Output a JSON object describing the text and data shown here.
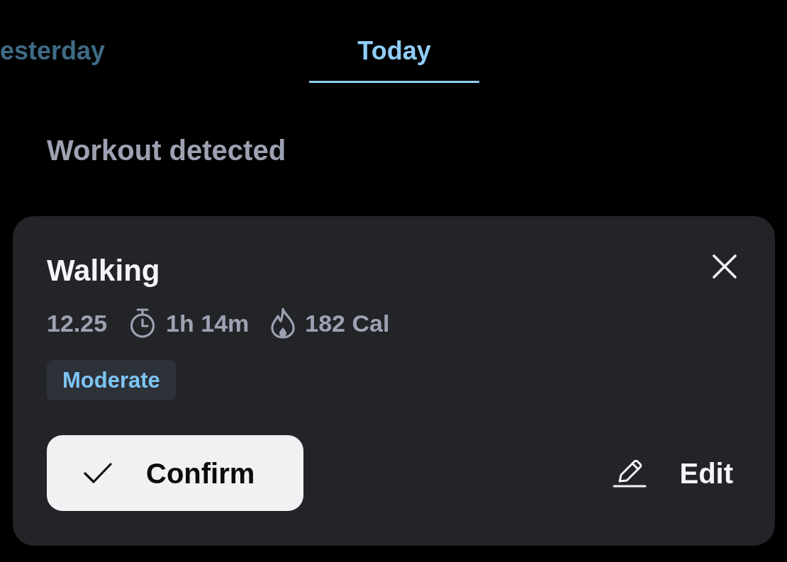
{
  "tabs": [
    {
      "label": "esterday",
      "selected": false
    },
    {
      "label": "Today",
      "selected": true
    }
  ],
  "section_title": "Workout detected",
  "workout_card": {
    "title": "Walking",
    "stats": [
      {
        "kind": "plain",
        "text": "12.25"
      },
      {
        "kind": "duration",
        "text": "1h 14m"
      },
      {
        "kind": "calories",
        "text": "182 Cal"
      }
    ],
    "intensity_badge": "Moderate",
    "buttons": [
      {
        "kind": "confirm",
        "label": "Confirm"
      },
      {
        "kind": "edit",
        "label": "Edit"
      }
    ]
  }
}
